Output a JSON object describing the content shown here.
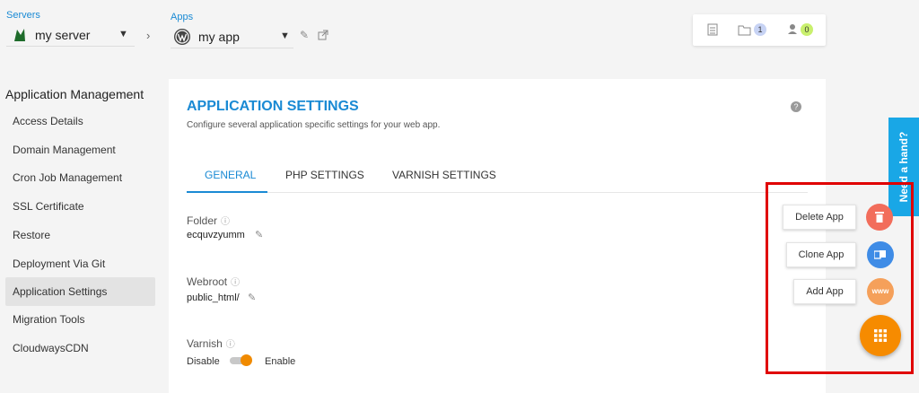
{
  "top": {
    "servers_label": "Servers",
    "server_value": "my server",
    "apps_label": "Apps",
    "app_value": "my app",
    "folder_badge": "1",
    "user_badge": "0"
  },
  "sidebar": {
    "title": "Application Management",
    "items": [
      {
        "label": "Access Details"
      },
      {
        "label": "Domain Management"
      },
      {
        "label": "Cron Job Management"
      },
      {
        "label": "SSL Certificate"
      },
      {
        "label": "Restore"
      },
      {
        "label": "Deployment Via Git"
      },
      {
        "label": "Application Settings"
      },
      {
        "label": "Migration Tools"
      },
      {
        "label": "CloudwaysCDN"
      }
    ]
  },
  "panel": {
    "title": "APPLICATION SETTINGS",
    "subtitle": "Configure several application specific settings for your web app.",
    "help": "?",
    "tabs": [
      {
        "label": "GENERAL"
      },
      {
        "label": "PHP SETTINGS"
      },
      {
        "label": "VARNISH SETTINGS"
      }
    ]
  },
  "fields": {
    "folder_label": "Folder",
    "folder_value": "ecquvzyumm",
    "webroot_label": "Webroot",
    "webroot_value": "public_html/",
    "varnish_label": "Varnish",
    "disable_label": "Disable",
    "enable_label": "Enable",
    "info_icon": "ⓘ"
  },
  "help_tab": "Need a hand?",
  "actions": {
    "delete": "Delete App",
    "clone": "Clone App",
    "add": "Add App",
    "www": "www"
  },
  "colors": {
    "accent": "#1a8ad4",
    "fab": "#f68b00",
    "delete": "#f26d5b",
    "clone": "#3f8ce6",
    "add": "#f5a05a",
    "highlight": "#e00000"
  }
}
